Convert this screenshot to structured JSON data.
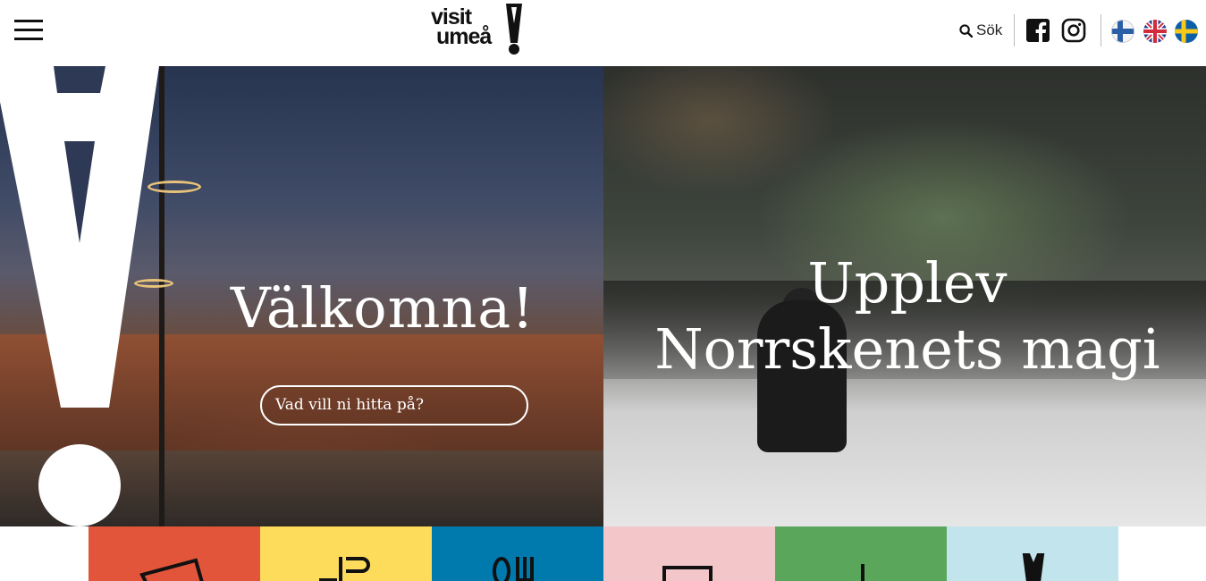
{
  "header": {
    "menu_icon": "hamburger-menu-icon",
    "logo": {
      "line1": "visit",
      "line2": "umeå"
    },
    "search": {
      "icon": "search-icon",
      "label": "Sök"
    },
    "social": [
      {
        "name": "facebook",
        "icon": "facebook-icon"
      },
      {
        "name": "instagram",
        "icon": "instagram-icon"
      }
    ],
    "languages": [
      {
        "code": "fi",
        "icon": "finland-flag-icon"
      },
      {
        "code": "en",
        "icon": "uk-flag-icon"
      },
      {
        "code": "sv",
        "icon": "sweden-flag-icon"
      }
    ]
  },
  "hero": {
    "left": {
      "title": "Välkomna!",
      "cta_label": "Vad vill ni hitta på?"
    },
    "right": {
      "title": "Upplev Norrskenets magi"
    }
  },
  "tiles": [
    {
      "color": "#e2553a",
      "icon": "ticket-icon"
    },
    {
      "color": "#fddc5c",
      "icon": "bed-icon"
    },
    {
      "color": "#0079ad",
      "icon": "food-icon"
    },
    {
      "color": "#f3c7ca",
      "icon": "shopping-icon"
    },
    {
      "color": "#5aa75b",
      "icon": "map-pin-icon"
    },
    {
      "color": "#c2e4ec",
      "icon": "exclamation-logo-icon"
    }
  ],
  "colors": {
    "accent_white": "#ffffff",
    "text_dark": "#111111"
  }
}
